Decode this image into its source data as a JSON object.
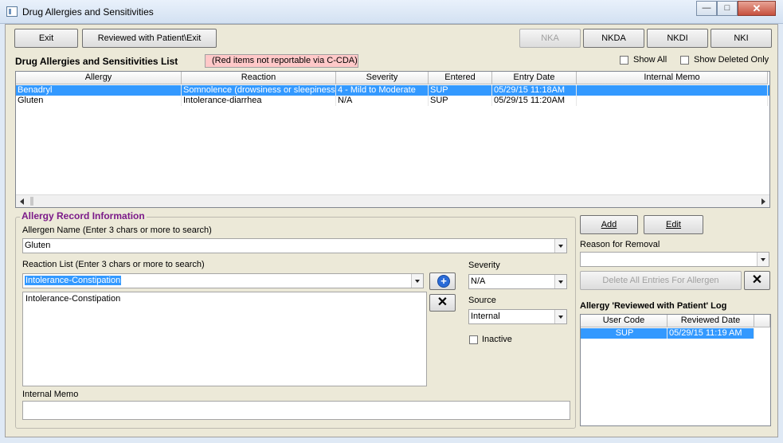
{
  "window": {
    "title": "Drug Allergies and Sensitivities",
    "minimize": "—",
    "maximize": "□",
    "close": "✕"
  },
  "toolbar": {
    "exit": "Exit",
    "reviewed_exit": "Reviewed with Patient\\Exit",
    "nka": "NKA",
    "nkda": "NKDA",
    "nkdi": "NKDI",
    "nki": "NKI"
  },
  "list_section": {
    "title": "Drug Allergies and Sensitivities List",
    "note": "(Red items not reportable via C-CDA)",
    "show_all": "Show All",
    "show_deleted": "Show Deleted Only"
  },
  "grid": {
    "columns": [
      "Allergy",
      "Reaction",
      "Severity",
      "Entered",
      "Entry Date",
      "Internal Memo"
    ],
    "rows": [
      {
        "allergy": "Benadryl",
        "reaction": "Somnolence (drowsiness or sleepiness)",
        "severity": "4 - Mild to Moderate",
        "entered": "SUP",
        "entry_date": "05/29/15 11:18AM",
        "memo": ""
      },
      {
        "allergy": "Gluten",
        "reaction": "Intolerance-diarrhea",
        "severity": "N/A",
        "entered": "SUP",
        "entry_date": "05/29/15 11:20AM",
        "memo": ""
      }
    ]
  },
  "record": {
    "title": "Allergy Record Information",
    "allergen_label": "Allergen Name (Enter 3 chars or more to search)",
    "allergen_value": "Gluten",
    "reaction_label": "Reaction List (Enter 3 chars or more to search)",
    "reaction_value": "Intolerance-Constipation",
    "reaction_items": [
      "Intolerance-Constipation"
    ],
    "severity_label": "Severity",
    "severity_value": "N/A",
    "source_label": "Source",
    "source_value": "Internal",
    "inactive_label": "Inactive",
    "memo_label": "Internal Memo",
    "memo_value": ""
  },
  "side": {
    "add": "Add",
    "edit": "Edit",
    "removal_label": "Reason for Removal",
    "removal_value": "",
    "delete_all": "Delete All Entries For Allergen",
    "log_title": "Allergy 'Reviewed with Patient' Log",
    "log_columns": [
      "User Code",
      "Reviewed Date"
    ],
    "log_rows": [
      {
        "user": "SUP",
        "date": "05/29/15 11:19 AM"
      }
    ]
  },
  "icons": {
    "add": "plus-circle-icon",
    "remove": "x-icon",
    "window": "app-window-icon"
  },
  "colors": {
    "selection": "#3399ff",
    "legend": "#7b1a89",
    "note_bg": "#ffc8c8",
    "add_icon": "#2a6bd8"
  }
}
